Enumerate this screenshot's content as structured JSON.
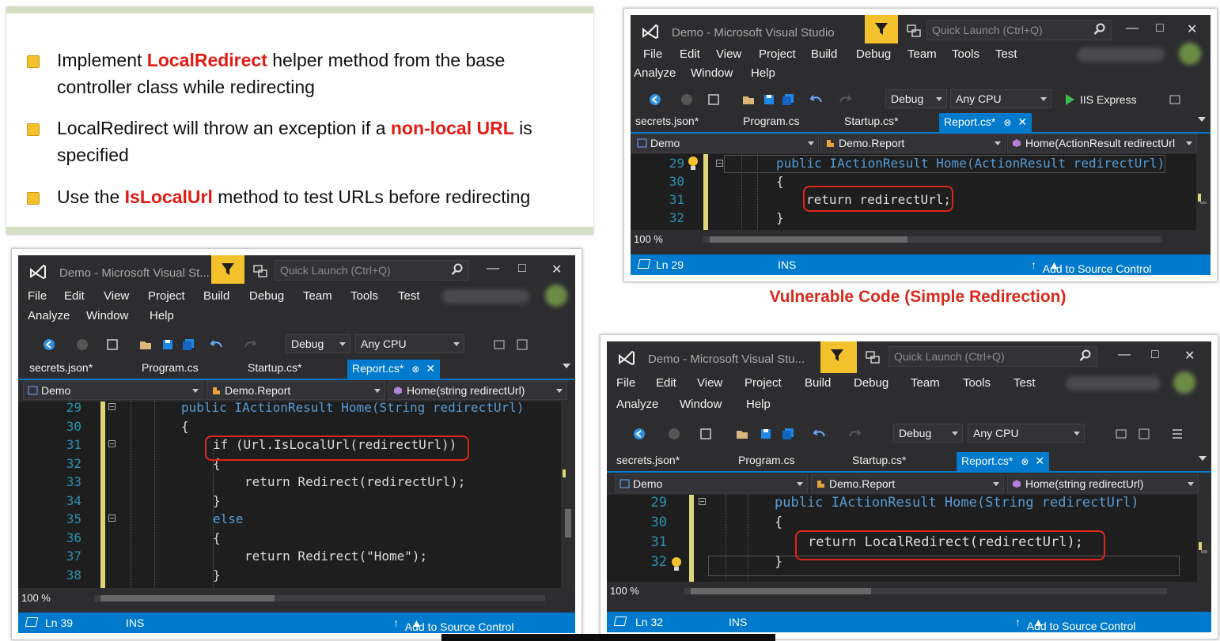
{
  "slide": {
    "bullets": [
      {
        "parts": [
          "Implement ",
          "LocalRedirect",
          " helper method from the base controller class while redirecting"
        ]
      },
      {
        "parts": [
          "LocalRedirect will throw an exception if a ",
          "non-local URL",
          " is specified"
        ]
      },
      {
        "parts": [
          "Use the ",
          "IsLocalUrl",
          " method to test URLs before redirecting"
        ]
      }
    ],
    "caption": "Vulnerable Code (Simple Redirection)"
  },
  "menu": {
    "row1": [
      "File",
      "Edit",
      "View",
      "Project",
      "Build",
      "Debug",
      "Team",
      "Tools",
      "Test"
    ],
    "row2": [
      "Analyze",
      "Window",
      "Help"
    ]
  },
  "toolbar": {
    "config": "Debug",
    "platform": "Any CPU",
    "run": "IIS Express"
  },
  "quick_launch": "Quick Launch (Ctrl+Q)",
  "tabs": [
    "secrets.json*",
    "Program.cs",
    "Startup.cs*",
    "Report.cs*"
  ],
  "windows": {
    "top": {
      "title": "Demo - Microsoft Visual Studio",
      "nav": [
        "Demo",
        "Demo.Report",
        "Home(ActionResult redirectUrl"
      ],
      "line_numbers": [
        "29",
        "30",
        "31",
        "32"
      ],
      "code": [
        "public IActionResult Home(ActionResult redirectUrl)",
        "{",
        "return redirectUrl;",
        "}"
      ],
      "zoom": "100 %",
      "status_line": "Ln 29",
      "status_mode": "INS",
      "status_action": "Add to Source Control"
    },
    "left": {
      "title": "Demo - Microsoft Visual St...",
      "nav": [
        "Demo",
        "Demo.Report",
        "Home(string redirectUrl)"
      ],
      "line_numbers": [
        "29",
        "30",
        "31",
        "32",
        "33",
        "34",
        "35",
        "36",
        "37",
        "38"
      ],
      "code": [
        "public IActionResult Home(String redirectUrl)",
        "{",
        "if (Url.IsLocalUrl(redirectUrl))",
        "{",
        "return Redirect(redirectUrl);",
        "}",
        "else",
        "{",
        "return Redirect(\"Home\");",
        "}"
      ],
      "zoom": "100 %",
      "status_line": "Ln 39",
      "status_mode": "INS",
      "status_action": "Add to Source Control"
    },
    "right": {
      "title": "Demo - Microsoft Visual Stu...",
      "nav": [
        "Demo",
        "Demo.Report",
        "Home(string redirectUrl)"
      ],
      "line_numbers": [
        "29",
        "30",
        "31",
        "32"
      ],
      "code": [
        "public IActionResult Home(String redirectUrl)",
        "{",
        "return LocalRedirect(redirectUrl);",
        "}"
      ],
      "zoom": "100 %",
      "status_line": "Ln 32",
      "status_mode": "INS",
      "status_action": "Add to Source Control"
    }
  },
  "colors": {
    "highlight": "#e21b14",
    "vs_blue": "#007acc",
    "bullet": "#f3c12c",
    "box": "#e0261b"
  },
  "icons": [
    "vs-logo-icon",
    "filter-icon",
    "search-icon",
    "minimize-icon",
    "maximize-icon",
    "close-icon",
    "play-icon",
    "lightbulb-icon"
  ]
}
